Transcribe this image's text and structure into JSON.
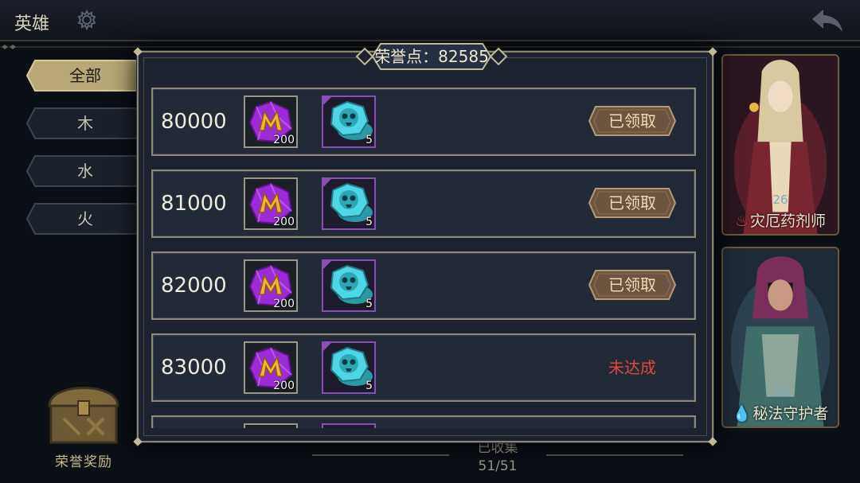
{
  "topbar": {
    "title": "英雄"
  },
  "filters": [
    {
      "label": "全部",
      "active": true
    },
    {
      "label": "木",
      "active": false
    },
    {
      "label": "水",
      "active": false
    },
    {
      "label": "火",
      "active": false
    }
  ],
  "chest": {
    "label": "荣誉奖励"
  },
  "collection": {
    "label": "已收集",
    "count": "51/51"
  },
  "heroes": [
    {
      "name": "灾厄药剂师",
      "level": "26"
    },
    {
      "name": "秘法守护者",
      "level": "26"
    }
  ],
  "modal": {
    "header": "荣誉点：82585",
    "rows": [
      {
        "points": "80000",
        "rewards": [
          {
            "icon": "purple-gem-icon",
            "qty": "200"
          },
          {
            "icon": "skull-token-icon",
            "qty": "5"
          }
        ],
        "status": "已领取",
        "status_type": "claimed"
      },
      {
        "points": "81000",
        "rewards": [
          {
            "icon": "purple-gem-icon",
            "qty": "200"
          },
          {
            "icon": "skull-token-icon",
            "qty": "5"
          }
        ],
        "status": "已领取",
        "status_type": "claimed"
      },
      {
        "points": "82000",
        "rewards": [
          {
            "icon": "purple-gem-icon",
            "qty": "200"
          },
          {
            "icon": "skull-token-icon",
            "qty": "5"
          }
        ],
        "status": "已领取",
        "status_type": "claimed"
      },
      {
        "points": "83000",
        "rewards": [
          {
            "icon": "purple-gem-icon",
            "qty": "200"
          },
          {
            "icon": "skull-token-icon",
            "qty": "5"
          }
        ],
        "status": "未达成",
        "status_type": "not-reached"
      }
    ]
  },
  "colors": {
    "not_reached": "#d94a3c",
    "claimed_button": "#6b5440",
    "frame": "#8d8876"
  }
}
